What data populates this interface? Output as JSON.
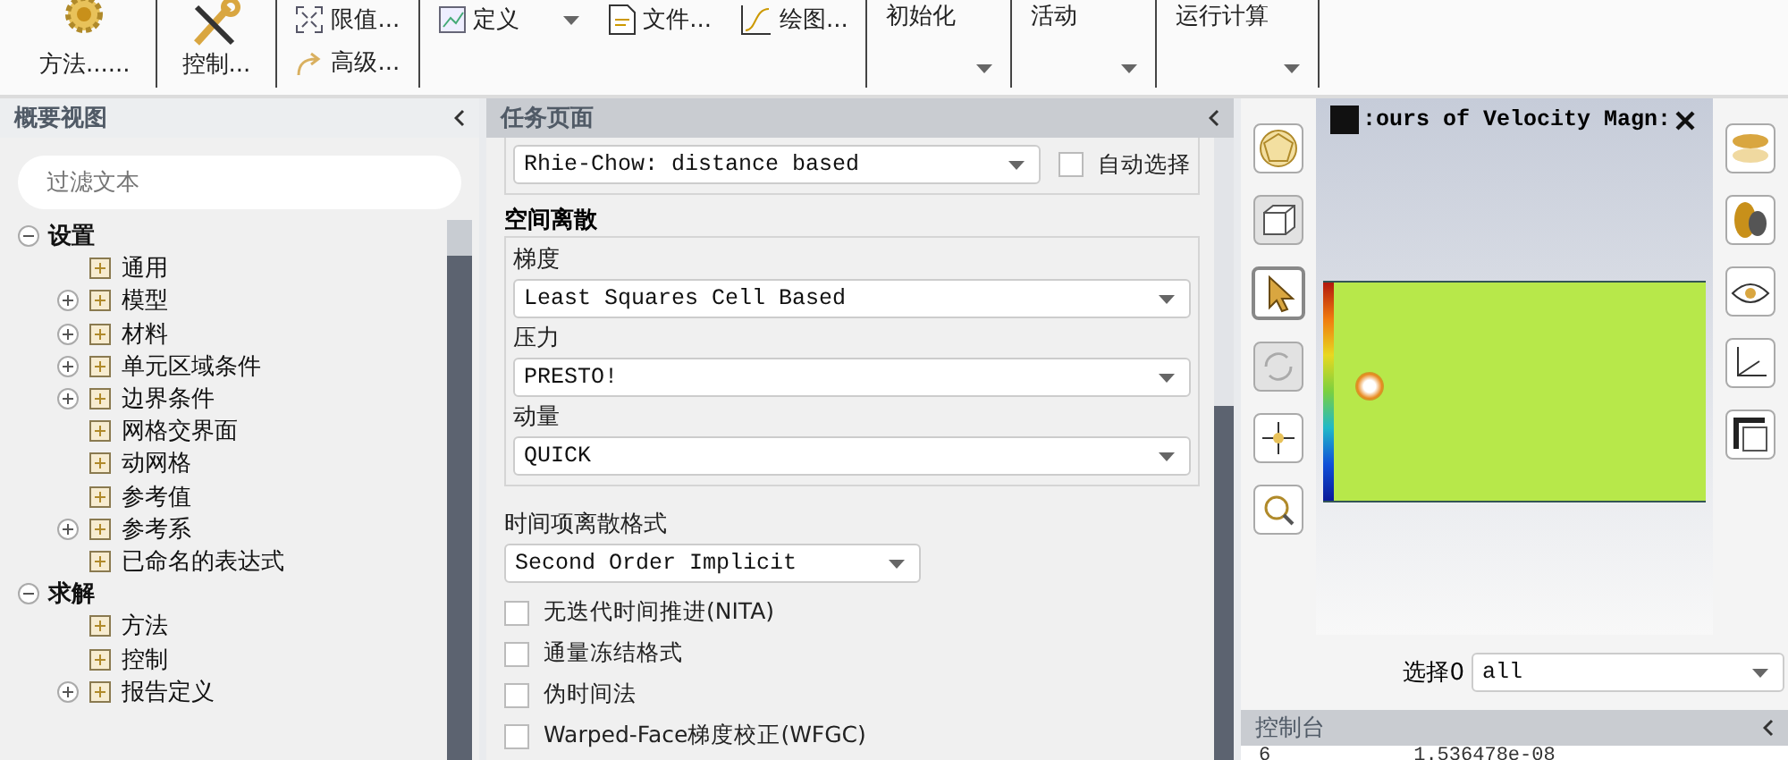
{
  "ribbon": {
    "groups": [
      {
        "kind": "big",
        "label": "方法......"
      },
      {
        "kind": "big",
        "label": "控制..."
      },
      {
        "kind": "small",
        "items": [
          "限值...",
          "高级..."
        ]
      },
      {
        "kind": "row",
        "items": [
          {
            "label": "定义"
          },
          {
            "label": "文件..."
          },
          {
            "label": "绘图..."
          }
        ]
      },
      {
        "kind": "menu",
        "label": "初始化"
      },
      {
        "kind": "menu",
        "label": "活动"
      },
      {
        "kind": "menu",
        "label": "运行计算"
      }
    ]
  },
  "outline": {
    "title": "概要视图",
    "filter_placeholder": "过滤文本",
    "tree": [
      {
        "label": "设置",
        "expanded": true,
        "children": [
          {
            "label": "通用"
          },
          {
            "label": "模型",
            "expanded": false
          },
          {
            "label": "材料",
            "expanded": false
          },
          {
            "label": "单元区域条件",
            "expanded": false
          },
          {
            "label": "边界条件",
            "expanded": false
          },
          {
            "label": "网格交界面"
          },
          {
            "label": "动网格"
          },
          {
            "label": "参考值"
          },
          {
            "label": "参考系",
            "expanded": false
          },
          {
            "label": "已命名的表达式"
          }
        ]
      },
      {
        "label": "求解",
        "expanded": true,
        "children": [
          {
            "label": "方法"
          },
          {
            "label": "控制"
          },
          {
            "label": "报告定义",
            "expanded": false
          }
        ]
      }
    ]
  },
  "task_page": {
    "title": "任务页面",
    "coupling": {
      "value": "Rhie-Chow: distance based",
      "auto_select": {
        "label": "自动选择",
        "checked": false
      }
    },
    "spatial": {
      "title": "空间离散",
      "fields": [
        {
          "label": "梯度",
          "value": "Least Squares Cell Based"
        },
        {
          "label": "压力",
          "value": "PRESTO!"
        },
        {
          "label": "动量",
          "value": "QUICK"
        }
      ]
    },
    "transient": {
      "label": "时间项离散格式",
      "value": "Second Order Implicit"
    },
    "options": [
      {
        "label": "无迭代时间推进(NITA)",
        "checked": false
      },
      {
        "label": "通量冻结格式",
        "checked": false
      },
      {
        "label": "伪时间法",
        "checked": false
      },
      {
        "label": "Warped-Face梯度校正(WFGC)",
        "checked": false
      }
    ]
  },
  "graphics": {
    "title": ":ours of Velocity Magn:",
    "select_label": "选择0",
    "select_value": "all"
  },
  "console": {
    "title": "控制台",
    "row": [
      "6",
      "1.536478e-08"
    ]
  }
}
